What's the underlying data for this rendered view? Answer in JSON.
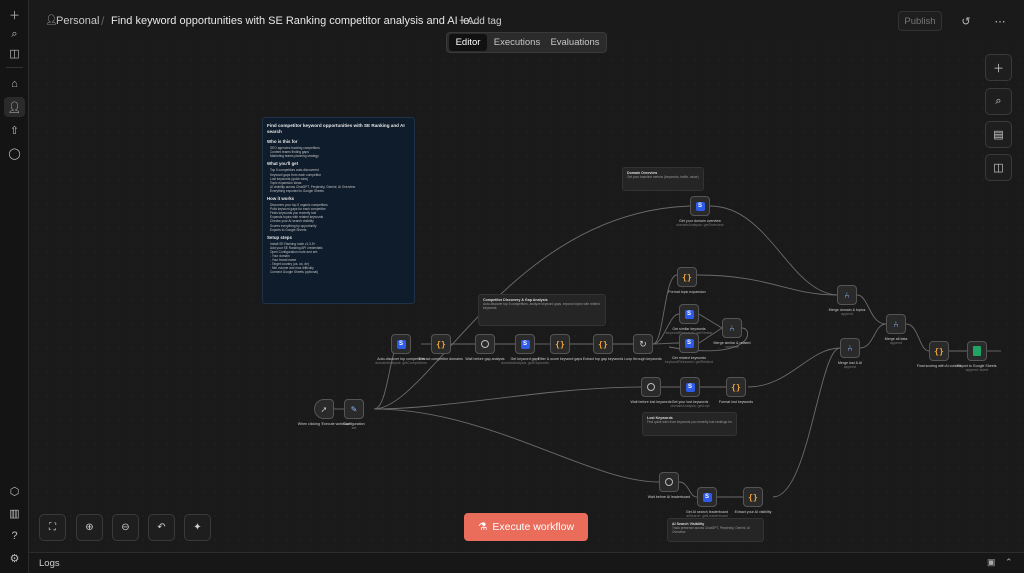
{
  "header": {
    "project": "Personal",
    "title": "Find keyword opportunities with SE Ranking competitor analysis and AI le...",
    "add_tag": "+ Add tag",
    "publish": "Publish"
  },
  "tabs": [
    "Editor",
    "Executions",
    "Evaluations"
  ],
  "active_tab": "Editor",
  "execute_button": "Execute workflow",
  "logs_label": "Logs",
  "note": {
    "title": "Find competitor keyword opportunities with SE Ranking and AI search",
    "sections": [
      {
        "heading": "Who is this for",
        "items": [
          "SEO agencies tracking competitors",
          "Content teams finding gaps",
          "Marketing teams planning strategy"
        ]
      },
      {
        "heading": "What you'll get",
        "items": [
          "Top 5 competitors auto-discovered",
          "Keyword gaps from each competitor",
          "Lost keywords (quick wins)",
          "Topic expansion ideas",
          "AI visibility across ChatGPT, Perplexity, Gemini, AI Overview",
          "Everything exported to Google Sheets"
        ]
      },
      {
        "heading": "How it works",
        "items": [
          "Discovers your top 5 organic competitors",
          "Pulls keyword gaps for each competitor",
          "Finds keywords you recently lost",
          "Expands topics with related keywords",
          "Checks your AI search visibility",
          "Scores everything by opportunity",
          "Exports to Google Sheets"
        ]
      },
      {
        "heading": "Setup steps",
        "items": [
          "Install SE Ranking node v1.3.5+",
          "Add your SE Ranking API credentials",
          "Open Configuration node and set:",
          "- Your domain",
          "- Your brand name",
          "- Target country (us, uk, de)",
          "- Min volume and max difficulty",
          "Connect Google Sheets (optional)"
        ]
      }
    ]
  },
  "stickies": {
    "domain_overview": {
      "title": "Domain Overview",
      "body": "Get your baseline metrics (keywords, traffic, value)"
    },
    "competitor_discovery": {
      "title": "Competitor Discovery & Gap Analysis",
      "body": "Auto-discover top 5 competitors, analyze keyword gaps, expand topics with related keywords"
    },
    "lost_keywords": {
      "title": "Lost Keywords",
      "body": "Find quick wins from keywords you recently lost rankings for"
    },
    "ai_search": {
      "title": "AI Search Visibility",
      "body": "Track presence across ChatGPT, Perplexity, Gemini, AI Overview"
    }
  },
  "nodes": [
    {
      "id": "trigger",
      "label": "When clicking 'Execute workflow'",
      "sub": "",
      "icon": "cursor-icon"
    },
    {
      "id": "config",
      "label": "Configuration",
      "sub": "set",
      "icon": "pencil-icon"
    },
    {
      "id": "auto_discover",
      "label": "Auto-discover top competitors",
      "sub": "domainAnalysis: getCompetitors",
      "icon": "seranking-icon"
    },
    {
      "id": "extract_domains",
      "label": "Extract competitor domains",
      "sub": "",
      "icon": "code-icon"
    },
    {
      "id": "wait_gap",
      "label": "Wait before gap analysis",
      "sub": "",
      "icon": "wait-icon"
    },
    {
      "id": "get_gaps",
      "label": "Get keyword gaps",
      "sub": "domainAnalysis: getKeywords",
      "icon": "seranking-icon"
    },
    {
      "id": "filter_gaps",
      "label": "Filter & score keyword gaps",
      "sub": "",
      "icon": "code-icon"
    },
    {
      "id": "extract_topics",
      "label": "Extract top gap keywords",
      "sub": "",
      "icon": "code-icon"
    },
    {
      "id": "loop",
      "label": "Loop through keywords",
      "sub": "",
      "icon": "loop-icon"
    },
    {
      "id": "domain_overview",
      "label": "Get your domain overview",
      "sub": "domainAnalysis: getOverview",
      "icon": "seranking-icon"
    },
    {
      "id": "format_topic",
      "label": "Format topic expansion",
      "sub": "",
      "icon": "code-icon"
    },
    {
      "id": "similar_kw",
      "label": "Get similar keywords",
      "sub": "keywordResearch: getSimilar",
      "icon": "seranking-icon"
    },
    {
      "id": "related_kw",
      "label": "Get related keywords",
      "sub": "keywordResearch: getRelated",
      "icon": "seranking-icon"
    },
    {
      "id": "merge_sr",
      "label": "Merge similar & related",
      "sub": "combine",
      "icon": "merge-icon"
    },
    {
      "id": "merge_domain",
      "label": "Merge domain & topics",
      "sub": "append",
      "icon": "merge-icon"
    },
    {
      "id": "merge_all",
      "label": "Merge all data",
      "sub": "append",
      "icon": "merge-icon"
    },
    {
      "id": "merge_lost_ai",
      "label": "Merge lost & AI",
      "sub": "append",
      "icon": "merge-icon"
    },
    {
      "id": "final_scoring",
      "label": "Final scoring with AI context",
      "sub": "",
      "icon": "code-icon"
    },
    {
      "id": "export_sheets",
      "label": "Export to Google Sheets",
      "sub": "append: sheet",
      "icon": "sheets-icon"
    },
    {
      "id": "wait_lost",
      "label": "Wait before lost keywords",
      "sub": "",
      "icon": "wait-icon"
    },
    {
      "id": "lost_kw",
      "label": "Get your lost keywords",
      "sub": "domainAnalysis: getLost",
      "icon": "seranking-icon"
    },
    {
      "id": "format_lost",
      "label": "Format lost keywords",
      "sub": "",
      "icon": "code-icon"
    },
    {
      "id": "wait_ai",
      "label": "Wait before AI leaderboard",
      "sub": "",
      "icon": "wait-icon"
    },
    {
      "id": "ai_leaderboard",
      "label": "Get AI search leaderboard",
      "sub": "aiSearch: getLeaderboard",
      "icon": "seranking-icon"
    },
    {
      "id": "extract_ai",
      "label": "Extract your AI visibility",
      "sub": "",
      "icon": "code-icon"
    }
  ]
}
